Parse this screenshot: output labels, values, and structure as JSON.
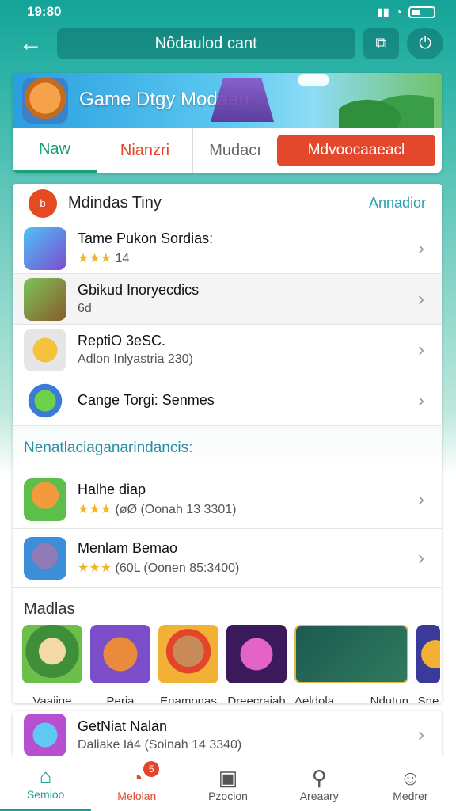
{
  "status_bar": {
    "time": "19:80",
    "icons": [
      "signal-icon",
      "wifi-icon",
      "battery-icon"
    ]
  },
  "topbar": {
    "title": "Nôdaulod cant",
    "back_icon": "arrow-left-icon",
    "share_icon": "square-share-icon",
    "power_icon": "power-icon"
  },
  "banner": {
    "title": "Game Dtgy Modaan"
  },
  "tabs": [
    {
      "label": "Naw"
    },
    {
      "label": "Nianzri"
    },
    {
      "label": "Mudacı"
    },
    {
      "label": "Mdvoocaaeacl"
    }
  ],
  "list": {
    "header": {
      "badge": "b",
      "title": "Mdindas Tiny",
      "link": "Annadior"
    },
    "rows": [
      {
        "title": "Tame Pukon Sordias:",
        "stars": "★★★",
        "sub": "14"
      },
      {
        "title": "Gbikud Inoryecdics",
        "sub": "6d"
      },
      {
        "title": "ReptiO 3eSC.",
        "sub": "Adlon Inlyastria 230)"
      },
      {
        "title": "Cange Torgi: Senmes",
        "sub": ""
      }
    ],
    "section_label": "Nenatlaciaganarindancis:",
    "rows2": [
      {
        "title": "Halhe diap",
        "stars": "★★★",
        "sub": "(øØ (Oonah 13 3301)"
      },
      {
        "title": "Menlam Bemao",
        "stars": "★★★",
        "sub": "(60L (Oonen 85:3400)"
      }
    ],
    "grid_title": "Madlas",
    "thumbs": [
      {
        "label": "Vaaiige"
      },
      {
        "label": "Peria"
      },
      {
        "label": "Enamonas"
      },
      {
        "label": "Dreecraiah"
      },
      {
        "label": "Aeldola"
      },
      {
        "label": "Ndutun"
      },
      {
        "label": "Sne"
      }
    ]
  },
  "bottom_card": {
    "title": "GetNiat Nalan",
    "sub": "Daliake Iá4 (Soinah 14 3340)"
  },
  "nav": [
    {
      "label": "Semioo",
      "icon": "home-icon"
    },
    {
      "label": "Melolan",
      "icon": "chat-icon",
      "badge": "5"
    },
    {
      "label": "Pzocion",
      "icon": "film-icon"
    },
    {
      "label": "Areaary",
      "icon": "search-icon"
    },
    {
      "label": "Medrer",
      "icon": "user-icon"
    }
  ],
  "colors": {
    "accent": "#1a9e94",
    "red": "#e2452a",
    "star": "#f0b623"
  }
}
